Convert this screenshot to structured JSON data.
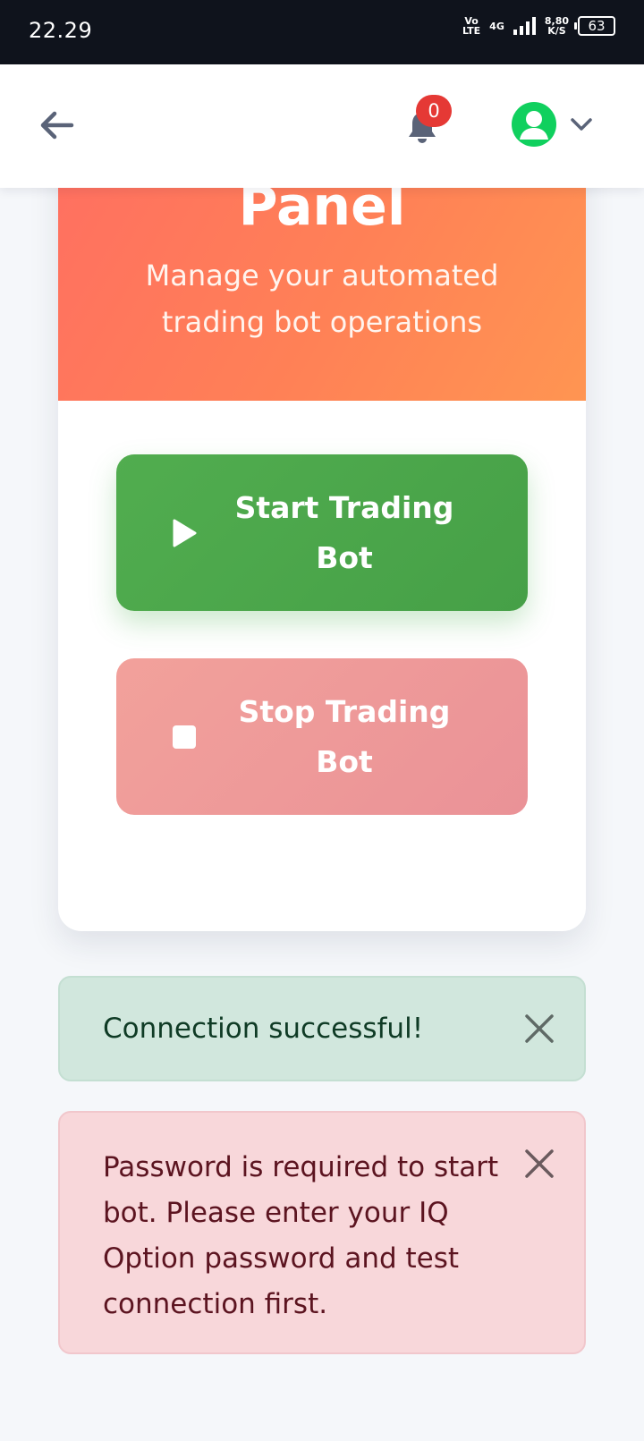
{
  "status_bar": {
    "time": "22.29",
    "volte_top": "Vo",
    "volte_bottom": "LTE",
    "network_type": "4G",
    "speed_value": "8,80",
    "speed_unit": "K/S",
    "battery": "63"
  },
  "header": {
    "notification_count": "0",
    "icons": {
      "back": "arrow-left-icon",
      "bell": "bell-icon",
      "user": "user-icon",
      "dropdown": "chevron-down-icon"
    }
  },
  "panel": {
    "title": "Panel",
    "subtitle": "Manage your automated trading bot operations",
    "start_button": {
      "label": "Start Trading Bot",
      "icon": "play-icon"
    },
    "stop_button": {
      "label": "Stop Trading Bot",
      "icon": "stop-icon"
    }
  },
  "alerts": {
    "success": {
      "message": "Connection successful!"
    },
    "danger": {
      "message": "Password is required to start bot. Please enter your IQ Option password and test connection first."
    }
  },
  "colors": {
    "accent_gradient_start": "#ff6f61",
    "accent_gradient_end": "#ff9552",
    "start_green": "#4caf50",
    "stop_red": "#ef9a9a",
    "badge_red": "#e53935",
    "avatar_green": "#10d05e"
  }
}
